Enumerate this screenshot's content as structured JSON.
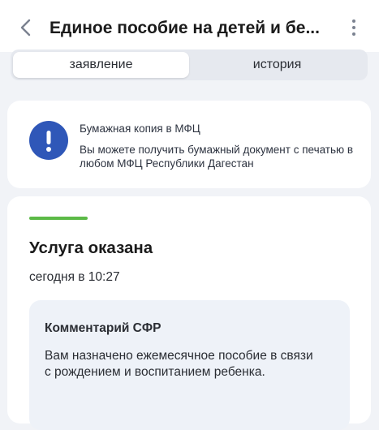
{
  "header": {
    "title": "Единое пособие на детей и бе...",
    "back_icon": "chevron-left-icon",
    "more_icon": "more-vertical-icon"
  },
  "tabs": [
    {
      "label": "заявление",
      "active": true
    },
    {
      "label": "история",
      "active": false
    }
  ],
  "notice": {
    "icon": "exclamation-icon",
    "title": "Бумажная копия в МФЦ",
    "text": "Вы можете получить бумажный документ с печатью в любом МФЦ Республики Дагестан"
  },
  "status": {
    "title": "Услуга оказана",
    "time": "сегодня в 10:27",
    "color": "#5cba47"
  },
  "comment": {
    "title": "Комментарий СФР",
    "text": "Вам назначено ежемесячное пособие в связи с рождением и воспитанием ребенка."
  },
  "colors": {
    "accent": "#2f57b8",
    "background": "#f1f3f7",
    "comment_bg": "#eef2f8"
  }
}
